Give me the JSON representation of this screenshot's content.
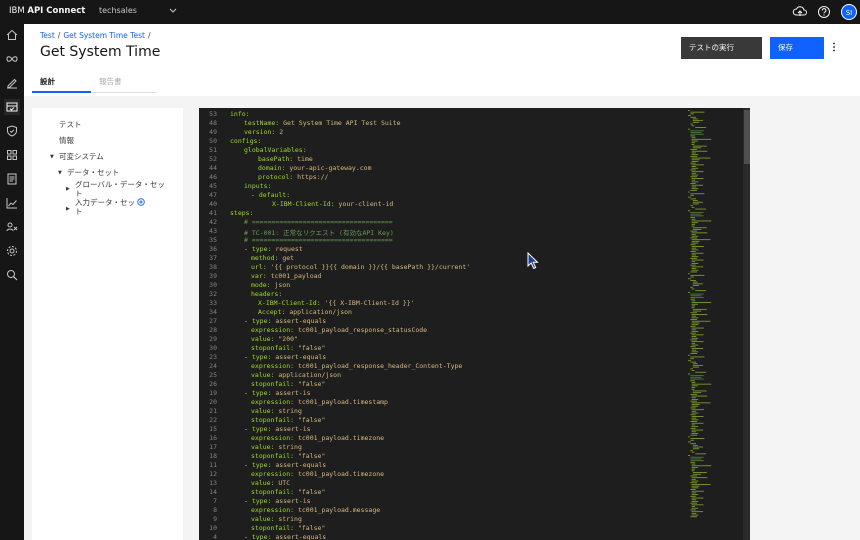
{
  "topbar": {
    "brand_prefix": "IBM",
    "brand_name": "API Connect",
    "org": "techsales",
    "avatar_initials": "SI"
  },
  "breadcrumb": [
    "Test",
    "Get System Time Test"
  ],
  "page_title": "Get System Time",
  "buttons": {
    "run": "テストの実行",
    "save": "保存"
  },
  "tabs": [
    {
      "label": "設計",
      "active": true
    },
    {
      "label": "報告書",
      "active": false
    }
  ],
  "tree": {
    "test": "テスト",
    "info": "情報",
    "variables": "可変システム",
    "dataset": "データ・セット",
    "global_dataset_1": "グローバル・データ・セッ",
    "global_dataset_2": "ト",
    "input_dataset_1": "入力データ・セッ",
    "input_dataset_2": "ト"
  },
  "code_lines": [
    {
      "n": "53",
      "i": 0,
      "k": "info:",
      "v": ""
    },
    {
      "n": "48",
      "i": 2,
      "k": "testName:",
      "v": " Get System Time API Test Suite"
    },
    {
      "n": "49",
      "i": 2,
      "k": "version:",
      "v": " 2"
    },
    {
      "n": "50",
      "i": 0,
      "k": "configs:",
      "v": ""
    },
    {
      "n": "51",
      "i": 2,
      "k": "globalVariables:",
      "v": ""
    },
    {
      "n": "52",
      "i": 4,
      "k": "basePath:",
      "v": " time"
    },
    {
      "n": "44",
      "i": 4,
      "k": "domain:",
      "v": " your-apic-gateway.com"
    },
    {
      "n": "46",
      "i": 4,
      "k": "protocol:",
      "v": " https://"
    },
    {
      "n": "45",
      "i": 2,
      "k": "inputs:",
      "v": ""
    },
    {
      "n": "47",
      "i": 3,
      "p": "- ",
      "k": "default:",
      "v": ""
    },
    {
      "n": "40",
      "i": 6,
      "k": "X-IBM-Client-Id:",
      "v": " your-client-id"
    },
    {
      "n": "41",
      "i": 0,
      "k": "steps:",
      "v": ""
    },
    {
      "n": "42",
      "i": 2,
      "c": "# ===================================="
    },
    {
      "n": "43",
      "i": 2,
      "c": "# TC-001: 正常なリクエスト (有効なAPI Key)"
    },
    {
      "n": "35",
      "i": 2,
      "c": "# ===================================="
    },
    {
      "n": "36",
      "i": 2,
      "p": "- ",
      "k": "type:",
      "v": " request"
    },
    {
      "n": "37",
      "i": 3,
      "k": "method:",
      "v": " get"
    },
    {
      "n": "38",
      "i": 3,
      "k": "url:",
      "v": " '{{ protocol }}{{ domain }}/{{ basePath }}/current'"
    },
    {
      "n": "39",
      "i": 3,
      "k": "var:",
      "v": " tc001_payload"
    },
    {
      "n": "30",
      "i": 3,
      "k": "mode:",
      "v": " json"
    },
    {
      "n": "32",
      "i": 3,
      "k": "headers:",
      "v": ""
    },
    {
      "n": "33",
      "i": 4,
      "k": "X-IBM-Client-Id:",
      "v": " '{{ X-IBM-Client-Id }}'"
    },
    {
      "n": "34",
      "i": 4,
      "k": "Accept:",
      "v": " application/json"
    },
    {
      "n": "27",
      "i": 2,
      "p": "- ",
      "k": "type:",
      "v": " assert-equals"
    },
    {
      "n": "28",
      "i": 3,
      "k": "expression:",
      "v": " tc001_payload_response_statusCode"
    },
    {
      "n": "29",
      "i": 3,
      "k": "value:",
      "v": " \"200\""
    },
    {
      "n": "30",
      "i": 3,
      "k": "stoponfail:",
      "v": " \"false\""
    },
    {
      "n": "23",
      "i": 2,
      "p": "- ",
      "k": "type:",
      "v": " assert-equals"
    },
    {
      "n": "24",
      "i": 3,
      "k": "expression:",
      "v": " tc001_payload_response_header_Content-Type"
    },
    {
      "n": "25",
      "i": 3,
      "k": "value:",
      "v": " application/json"
    },
    {
      "n": "26",
      "i": 3,
      "k": "stoponfail:",
      "v": " \"false\""
    },
    {
      "n": "19",
      "i": 2,
      "p": "- ",
      "k": "type:",
      "v": " assert-is"
    },
    {
      "n": "20",
      "i": 3,
      "k": "expression:",
      "v": " tc001_payload.timestamp"
    },
    {
      "n": "21",
      "i": 3,
      "k": "value:",
      "v": " string"
    },
    {
      "n": "22",
      "i": 3,
      "k": "stoponfail:",
      "v": " \"false\""
    },
    {
      "n": "15",
      "i": 2,
      "p": "- ",
      "k": "type:",
      "v": " assert-is"
    },
    {
      "n": "16",
      "i": 3,
      "k": "expression:",
      "v": " tc001_payload.timezone"
    },
    {
      "n": "17",
      "i": 3,
      "k": "value:",
      "v": " string"
    },
    {
      "n": "18",
      "i": 3,
      "k": "stoponfail:",
      "v": " \"false\""
    },
    {
      "n": "11",
      "i": 2,
      "p": "- ",
      "k": "type:",
      "v": " assert-equals"
    },
    {
      "n": "12",
      "i": 3,
      "k": "expression:",
      "v": " tc001_payload.timezone"
    },
    {
      "n": "13",
      "i": 3,
      "k": "value:",
      "v": " UTC"
    },
    {
      "n": "14",
      "i": 3,
      "k": "stoponfail:",
      "v": " \"false\""
    },
    {
      "n": "7",
      "i": 2,
      "p": "- ",
      "k": "type:",
      "v": " assert-is"
    },
    {
      "n": "8",
      "i": 3,
      "k": "expression:",
      "v": " tc001_payload.message"
    },
    {
      "n": "9",
      "i": 3,
      "k": "value:",
      "v": " string"
    },
    {
      "n": "10",
      "i": 3,
      "k": "stoponfail:",
      "v": " \"false\""
    },
    {
      "n": "4",
      "i": 2,
      "p": "- ",
      "k": "type:",
      "v": " assert-equals"
    }
  ],
  "icons": {
    "topbar": [
      "cloud-upload-icon",
      "help-icon"
    ],
    "nav": [
      "home-icon",
      "infinity-icon",
      "edit-icon",
      "test-icon",
      "shield-icon",
      "apps-icon",
      "document-icon",
      "analytics-icon",
      "users-icon",
      "settings-icon",
      "search-icon"
    ]
  },
  "colors": {
    "primary": "#0f62fe",
    "editor_bg": "#1e1e1e",
    "yaml_key": "#9cdc1e",
    "yaml_value": "#d7ba7d",
    "comment": "#6a9955"
  }
}
